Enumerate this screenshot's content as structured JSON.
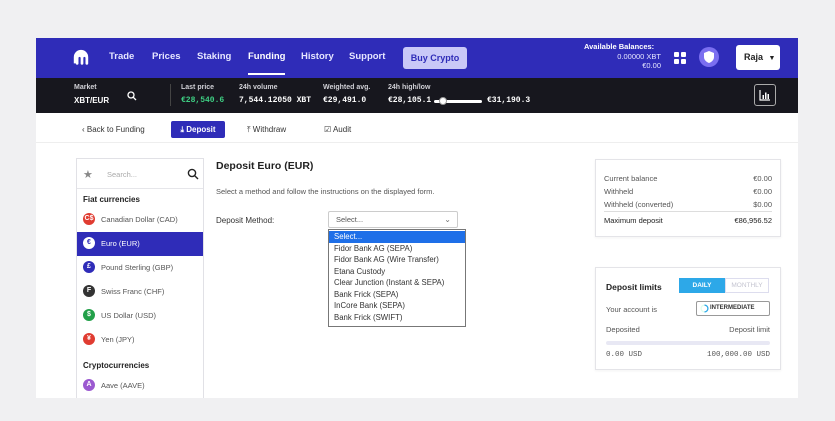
{
  "nav": {
    "items": [
      "Trade",
      "Prices",
      "Staking",
      "Funding",
      "History",
      "Support"
    ],
    "active": "Funding",
    "buy_crypto": "Buy Crypto",
    "balances_title": "Available Balances:",
    "balance_xbt": "0.00000 XBT",
    "balance_eur": "€0.00",
    "user": "Raja"
  },
  "market": {
    "market_label": "Market",
    "pair": "XBT/EUR",
    "last_price_label": "Last price",
    "last_price": "€28,540.6",
    "volume_label": "24h volume",
    "volume": "7,544.12050 XBT",
    "wavg_label": "Weighted avg.",
    "wavg": "€29,491.0",
    "highlow_label": "24h high/low",
    "low": "€28,105.1",
    "high": "€31,190.3"
  },
  "subnav": {
    "back": "‹ Back to Funding",
    "deposit": "Deposit",
    "withdraw": "Withdraw",
    "audit": "Audit"
  },
  "sidebar": {
    "search_placeholder": "Search...",
    "fiat_title": "Fiat currencies",
    "crypto_title": "Cryptocurrencies",
    "items": [
      {
        "label": "Canadian Dollar (CAD)",
        "symbol": "C$",
        "color": "#e03c31"
      },
      {
        "label": "Euro (EUR)",
        "symbol": "€",
        "color": "#2f2cb8"
      },
      {
        "label": "Pound Sterling (GBP)",
        "symbol": "£",
        "color": "#2f2cb8"
      },
      {
        "label": "Swiss Franc (CHF)",
        "symbol": "F",
        "color": "#333333"
      },
      {
        "label": "US Dollar (USD)",
        "symbol": "$",
        "color": "#22a049"
      },
      {
        "label": "Yen (JPY)",
        "symbol": "¥",
        "color": "#e03c31"
      }
    ],
    "crypto_items": [
      {
        "label": "Aave (AAVE)",
        "symbol": "A",
        "color": "#9b59d0"
      }
    ]
  },
  "main": {
    "title": "Deposit Euro (EUR)",
    "instructions": "Select a method and follow the instructions on the displayed form.",
    "method_label": "Deposit Method:",
    "select_value": "Select...",
    "options": [
      "Select...",
      "Fidor Bank AG (SEPA)",
      "Fidor Bank AG (Wire Transfer)",
      "Etana Custody",
      "Clear Junction (Instant & SEPA)",
      "Bank Frick (SEPA)",
      "InCore Bank (SEPA)",
      "Bank Frick (SWIFT)"
    ]
  },
  "balance_card": {
    "rows": [
      {
        "label": "Current balance",
        "value": "€0.00"
      },
      {
        "label": "Withheld",
        "value": "€0.00"
      },
      {
        "label": "Withheld (converted)",
        "value": "$0.00"
      },
      {
        "label": "Maximum deposit",
        "value": "€86,956.52"
      }
    ]
  },
  "limits": {
    "title": "Deposit limits",
    "daily": "DAILY",
    "monthly": "MONTHLY",
    "account_label": "Your account is",
    "tier": "INTERMEDIATE",
    "deposited_label": "Deposited",
    "limit_label": "Deposit limit",
    "deposited": "0.00 USD",
    "limit": "100,000.00 USD",
    "progress_fraction": 0
  },
  "colors": {
    "brand": "#2f2cb8",
    "market_bar": "#17171e",
    "positive": "#3ecf83",
    "option_highlight": "#1e6fe8",
    "daily_toggle": "#2da8e8"
  }
}
